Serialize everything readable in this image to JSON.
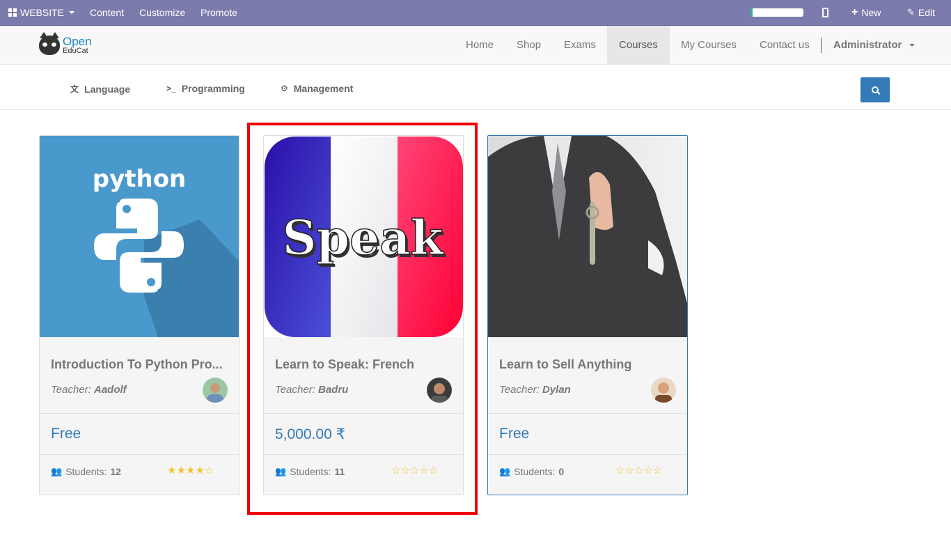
{
  "adminbar": {
    "website_label": "WEBSITE",
    "content_label": "Content",
    "customize_label": "Customize",
    "promote_label": "Promote",
    "progress": 0.04,
    "new_label": "New",
    "edit_label": "Edit"
  },
  "navbar": {
    "logo_line1": "Open",
    "logo_line2": "EduCat",
    "items": [
      "Home",
      "Shop",
      "Exams",
      "Courses",
      "My Courses",
      "Contact us"
    ],
    "active": "Courses",
    "user": "Administrator"
  },
  "categories": [
    {
      "label": "Language",
      "icon": "language-icon"
    },
    {
      "label": "Programming",
      "icon": "terminal-icon"
    },
    {
      "label": "Management",
      "icon": "gear-icon"
    }
  ],
  "courses": [
    {
      "title": "Introduction To Python Pro...",
      "teacher_prefix": "Teacher:",
      "teacher": "Aadolf",
      "price": "Free",
      "students_label": "Students:",
      "students": "12",
      "rating": 4,
      "thumb_text": "python"
    },
    {
      "title": "Learn to Speak: French",
      "teacher_prefix": "Teacher:",
      "teacher": "Badru",
      "price": "5,000.00 ₹",
      "students_label": "Students:",
      "students": "11",
      "rating": 0,
      "thumb_text": "Speak"
    },
    {
      "title": "Learn to Sell Anything",
      "teacher_prefix": "Teacher:",
      "teacher": "Dylan",
      "price": "Free",
      "students_label": "Students:",
      "students": "0",
      "rating": 0
    }
  ]
}
